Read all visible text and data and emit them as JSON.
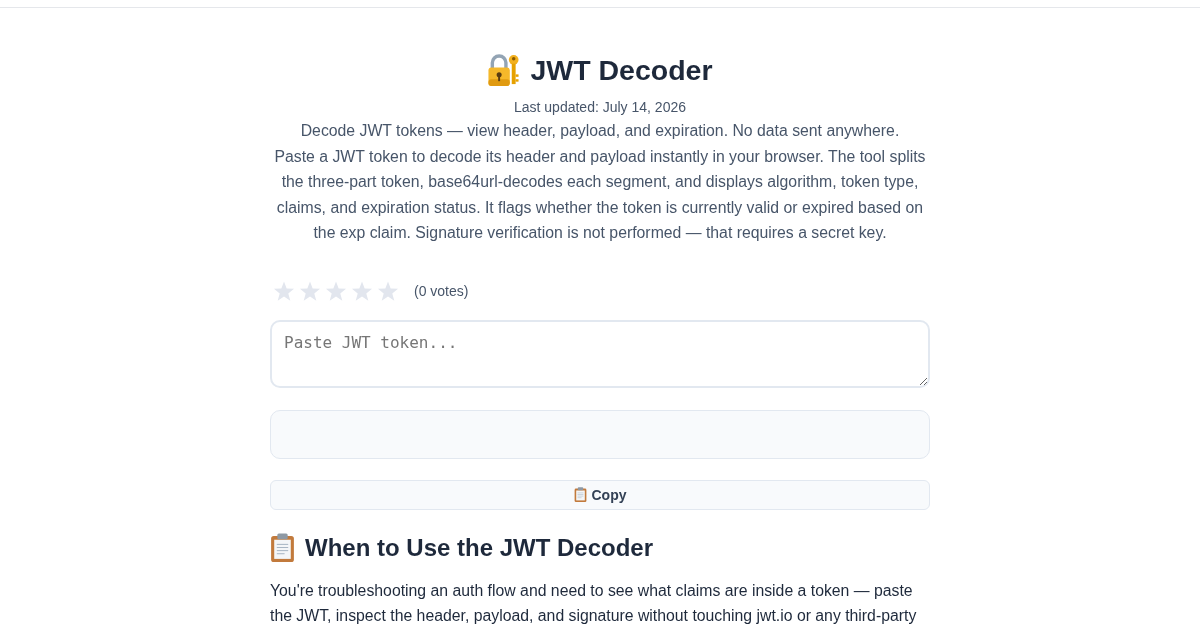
{
  "page": {
    "title": "JWT Decoder",
    "last_updated": "Last updated: July 14, 2026",
    "tagline": "Decode JWT tokens — view header, payload, and expiration. No data sent anywhere.",
    "description": "Paste a JWT token to decode its header and payload instantly in your browser. The tool splits the three-part token, base64url-decodes each segment, and displays algorithm, token type, claims, and expiration status. It flags whether the token is currently valid or expired based on the exp claim. Signature verification is not performed — that requires a secret key."
  },
  "rating": {
    "stars": 0,
    "votes": "(0 votes)"
  },
  "token_input": {
    "placeholder": "Paste JWT token..."
  },
  "copy_button": {
    "label": "Copy"
  },
  "section": {
    "heading": "When to Use the JWT Decoder",
    "paragraph": "You're troubleshooting an auth flow and need to see what claims are inside a token — paste the JWT, inspect the header, payload, and signature without touching jwt.io or any third-party"
  }
}
